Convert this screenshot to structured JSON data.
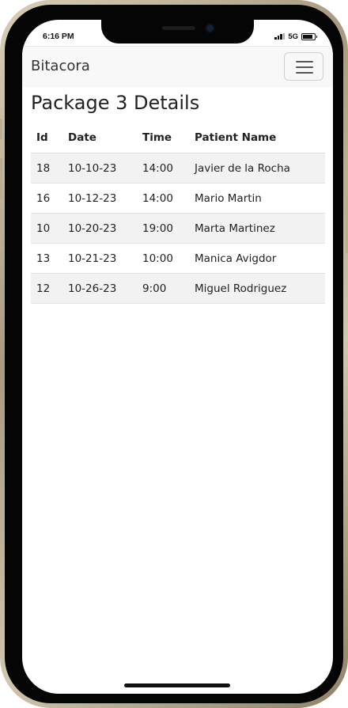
{
  "status_bar": {
    "time": "6:16 PM",
    "network": "5G",
    "battery_level": 0.85
  },
  "navbar": {
    "brand": "Bitacora",
    "menu_icon": "hamburger-menu-icon"
  },
  "page": {
    "title": "Package 3 Details"
  },
  "table": {
    "headers": {
      "id": "Id",
      "date": "Date",
      "time": "Time",
      "patient": "Patient Name"
    },
    "rows": [
      {
        "id": "18",
        "date": "10-10-23",
        "time": "14:00",
        "patient": "Javier de la Rocha"
      },
      {
        "id": "16",
        "date": "10-12-23",
        "time": "14:00",
        "patient": "Mario Martin"
      },
      {
        "id": "10",
        "date": "10-20-23",
        "time": "19:00",
        "patient": "Marta Martinez"
      },
      {
        "id": "13",
        "date": "10-21-23",
        "time": "10:00",
        "patient": "Manica Avigdor"
      },
      {
        "id": "12",
        "date": "10-26-23",
        "time": "9:00",
        "patient": "Miguel Rodriguez"
      }
    ]
  },
  "colors": {
    "navbar_bg": "#f8f8f8",
    "stripe_bg": "#f2f2f2",
    "text": "#222222"
  }
}
